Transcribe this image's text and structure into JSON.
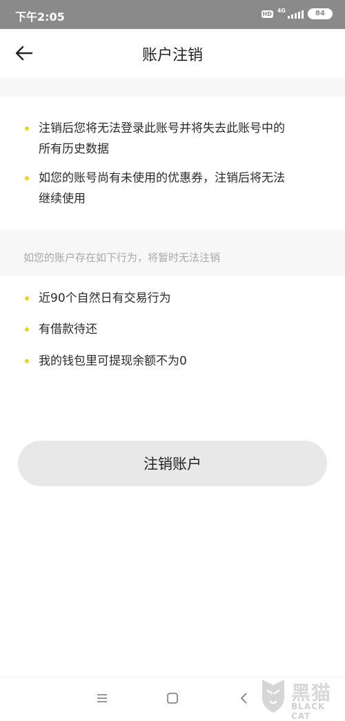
{
  "status_bar": {
    "time": "下午2:05",
    "hd": "HD",
    "network": "4G",
    "battery": "84"
  },
  "header": {
    "title": "账户注销",
    "back_icon": "back-arrow-icon"
  },
  "warnings": {
    "items": [
      {
        "line1": "注销后您将无法登录此账号并将失去此账号中的",
        "line2": "所有历史数据"
      },
      {
        "line1": "如您的账号尚有未使用的优惠券，注销后将无法",
        "line2": "继续使用"
      }
    ]
  },
  "conditions": {
    "note": "如您的账户存在如下行为，将暂时无法注销",
    "items": [
      "近90个自然日有交易行为",
      "有借款待还",
      "我的钱包里可提现余额不为0"
    ]
  },
  "action": {
    "button_label": "注销账户"
  },
  "bottom_nav": {
    "menu_icon": "menu-icon",
    "home_icon": "home-square-icon",
    "back_icon": "back-chevron-icon"
  },
  "watermark": {
    "cn": "黑猫",
    "en": "BLACK CAT",
    "logo_icon": "cat-shield-icon"
  },
  "colors": {
    "bullet": "#f2d21b",
    "status_bar": "#8a8a8a",
    "section_gap": "#f7f7f7",
    "button_bg": "#e8e8e8"
  }
}
